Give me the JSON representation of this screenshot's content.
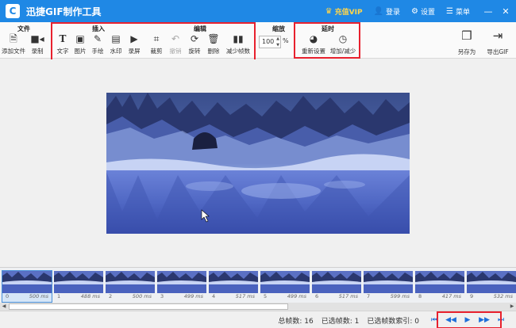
{
  "app": {
    "title": "迅捷GIF制作工具",
    "logo": "C"
  },
  "titlebar": {
    "vip_label": "充值VIP",
    "login_label": "登录",
    "settings_label": "设置",
    "menu_label": "菜单",
    "minimize": "—",
    "close": "✕"
  },
  "toolbar": {
    "file": {
      "title": "文件",
      "add_file": "添加文件",
      "record": "录制"
    },
    "insert": {
      "title": "插入",
      "text": "文字",
      "image": "图片",
      "draw": "手绘",
      "watermark": "水印",
      "screen_record": "录屏"
    },
    "edit": {
      "title": "编辑",
      "crop": "裁剪",
      "undo": "撤销",
      "rotate": "旋转",
      "delete": "删除",
      "reduce_frames": "减少帧数"
    },
    "zoom": {
      "title": "缩放",
      "value": "100",
      "unit": "%"
    },
    "delay": {
      "title": "延时",
      "reset": "重新设置",
      "adjust": "增加/减少"
    },
    "save_as": "另存为",
    "export_gif": "导出GIF"
  },
  "frames": [
    {
      "index": "0",
      "duration": "500 ms"
    },
    {
      "index": "1",
      "duration": "488 ms"
    },
    {
      "index": "2",
      "duration": "500 ms"
    },
    {
      "index": "3",
      "duration": "499 ms"
    },
    {
      "index": "4",
      "duration": "517 ms"
    },
    {
      "index": "5",
      "duration": "499 ms"
    },
    {
      "index": "6",
      "duration": "517 ms"
    },
    {
      "index": "7",
      "duration": "599 ms"
    },
    {
      "index": "8",
      "duration": "417 ms"
    },
    {
      "index": "9",
      "duration": "532 ms"
    }
  ],
  "status": {
    "total_frames": "总帧数: 16",
    "selected_frames": "已选帧数: 1",
    "selected_index": "已选帧数索引: 0"
  },
  "playback": {
    "first": "⏮",
    "prev": "◀◀",
    "play": "▶",
    "next": "▶▶",
    "last": "⏭"
  },
  "colors": {
    "titlebar": "#1f88e5",
    "highlight": "#e8212e",
    "vip": "#ffd54a"
  }
}
